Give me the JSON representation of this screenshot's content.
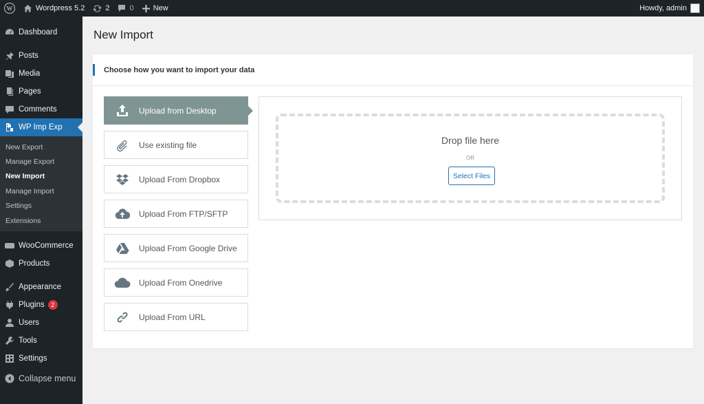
{
  "adminbar": {
    "site_name": "Wordpress 5.2",
    "updates_count": "2",
    "comments_count": "0",
    "new_label": "New",
    "greeting": "Howdy, admin"
  },
  "sidebar": {
    "items_top": [
      {
        "label": "Dashboard",
        "icon": "dashboard-icon"
      },
      {
        "label": "Posts",
        "icon": "pin-icon"
      },
      {
        "label": "Media",
        "icon": "media-icon"
      },
      {
        "label": "Pages",
        "icon": "pages-icon"
      },
      {
        "label": "Comments",
        "icon": "comment-icon"
      },
      {
        "label": "WP Imp Exp",
        "icon": "import-export-icon"
      }
    ],
    "submenu": [
      "New Export",
      "Manage Export",
      "New Import",
      "Manage Import",
      "Settings",
      "Extensions"
    ],
    "items_bottom": [
      {
        "label": "WooCommerce",
        "icon": "woo-icon"
      },
      {
        "label": "Products",
        "icon": "box-icon"
      },
      {
        "label": "Appearance",
        "icon": "brush-icon"
      },
      {
        "label": "Plugins",
        "icon": "plug-icon",
        "badge": "2"
      },
      {
        "label": "Users",
        "icon": "user-icon"
      },
      {
        "label": "Tools",
        "icon": "wrench-icon"
      },
      {
        "label": "Settings",
        "icon": "settings-icon"
      },
      {
        "label": "Collapse menu",
        "icon": "collapse-icon"
      }
    ]
  },
  "page": {
    "title": "New Import",
    "section_title": "Choose how you want to import your data"
  },
  "import_options": [
    {
      "label": "Upload from Desktop",
      "icon": "upload-icon",
      "selected": true
    },
    {
      "label": "Use existing file",
      "icon": "paperclip-icon"
    },
    {
      "label": "Upload From Dropbox",
      "icon": "dropbox-icon"
    },
    {
      "label": "Upload From FTP/SFTP",
      "icon": "cloud-upload-icon"
    },
    {
      "label": "Upload From Google Drive",
      "icon": "google-drive-icon"
    },
    {
      "label": "Upload From Onedrive",
      "icon": "cloud-icon"
    },
    {
      "label": "Upload From URL",
      "icon": "link-icon"
    }
  ],
  "dropzone": {
    "title": "Drop file here",
    "or": "OR",
    "button": "Select Files"
  },
  "colors": {
    "accent": "#2271b1",
    "selected_option": "#7f9593",
    "admin_dark": "#1d2327"
  }
}
